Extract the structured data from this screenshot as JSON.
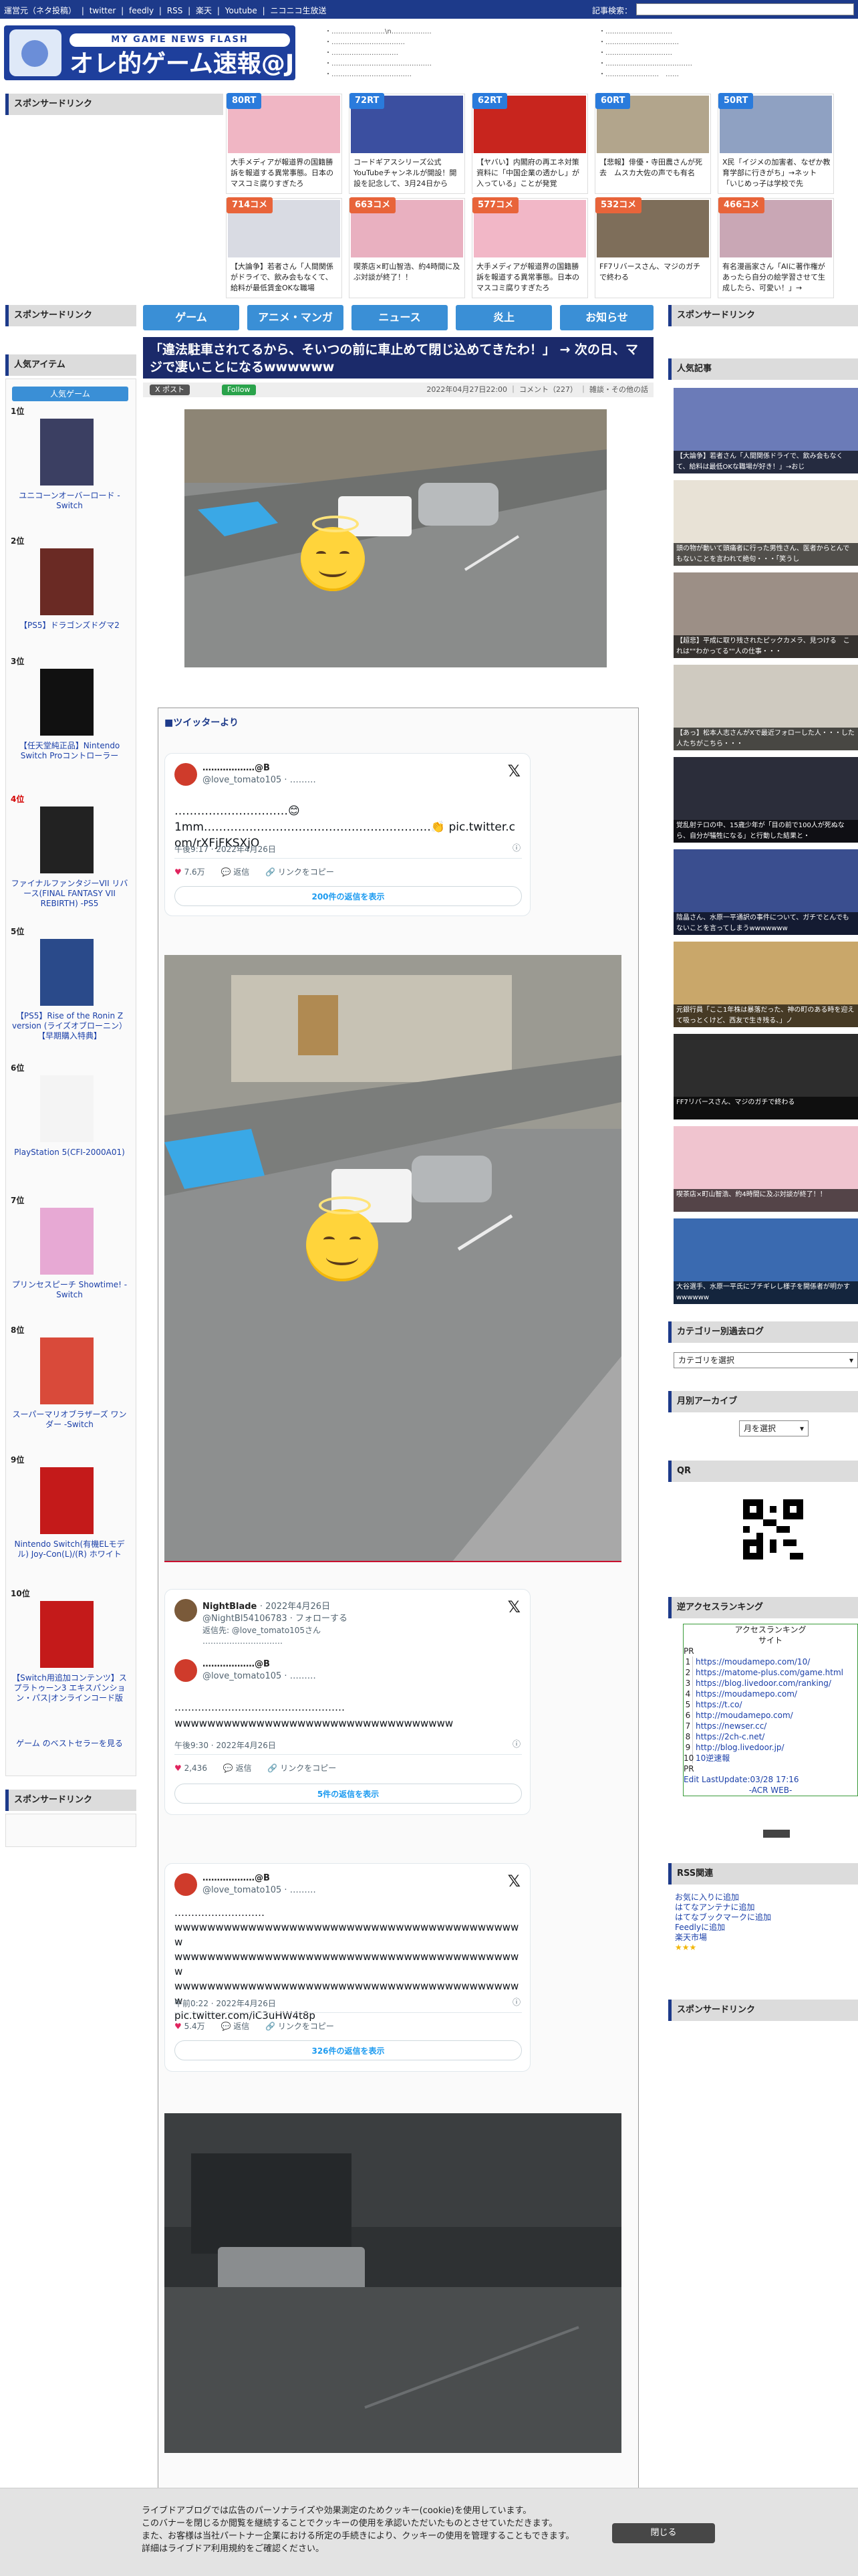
{
  "topbar": {
    "links": [
      "運営元（ネタ投稿）",
      "|",
      "twitter",
      "|",
      "feedly",
      "|",
      "RSS",
      "|",
      "楽天",
      "|",
      "Youtube",
      "|",
      "ニコニコ生放送"
    ],
    "search_label": "記事検索："
  },
  "logo": {
    "sub": "MY GAME NEWS FLASH",
    "main": "オレ的ゲーム速報@JIN"
  },
  "header_links": {
    "col1": [
      "……………………\\n………………",
      "……………………………",
      "…………………………",
      "………………………………………",
      "………………………………"
    ],
    "col2": [
      "…………………………",
      "……………………………",
      "…………………………",
      "…………………………………",
      "……………………　……"
    ]
  },
  "ads": [
    {
      "badge": "80RT",
      "kind": "rt",
      "caption": "大手メディアが報道界の国籍勝訴を報道する異常事態。日本のマスコミ腐りすぎたろ"
    },
    {
      "badge": "72RT",
      "kind": "rt",
      "caption": "コードギアスシリーズ公式YouTubeチャンネルが開設！開設を記念して、3月24日から"
    },
    {
      "badge": "62RT",
      "kind": "rt",
      "caption": "【ヤバい】内閣府の再エネ対策資料に「中国企業の透かし」が入っている」ことが発覚"
    },
    {
      "badge": "60RT",
      "kind": "rt",
      "caption": "【悲報】俳優・寺田農さんが死去　ムスカ大佐の声でも有名"
    },
    {
      "badge": "50RT",
      "kind": "rt",
      "caption": "X民「イジメの加害者、なぜか教育学部に行きがち」→ネット「いじめっ子は学校で先"
    },
    {
      "badge": "714コメ",
      "kind": "cm",
      "caption": "【大論争】若者さん「人間関係がドライで、飲み会もなくて、給料が最低賃金OKな職場"
    },
    {
      "badge": "663コメ",
      "kind": "cm",
      "caption": "喫茶店×町山智浩、約4時間に及ぶ対談が終了！！"
    },
    {
      "badge": "577コメ",
      "kind": "cm",
      "caption": "大手メディアが報道界の国籍勝訴を報道する異常事態。日本のマスコミ腐りすぎたろ"
    },
    {
      "badge": "532コメ",
      "kind": "cm",
      "caption": "FF7リバースさん、マジのガチで終わる"
    },
    {
      "badge": "466コメ",
      "kind": "cm",
      "caption": "有名漫画家さん「AIに著作権があったら自分の絵学習させて生成したら、可愛い！」→"
    }
  ],
  "side": {
    "sponsored": "スポンサードリンク",
    "popular_items": "人気アイテム",
    "popular_tab": "人気ゲーム",
    "popular_articles": "人気記事",
    "category_label": "カテゴリー別過去ログ",
    "category_select": "カテゴリを選択",
    "monthly_label": "月別アーカイブ",
    "monthly_select": "月を選択",
    "qr_label": "QR",
    "access_label": "逆アクセスランキング",
    "rss_label": "RSS関連",
    "see_more": "ゲーム のベストセラーを見る"
  },
  "nav": [
    "ゲーム",
    "アニメ・マンガ",
    "ニュース",
    "炎上",
    "お知らせ"
  ],
  "article": {
    "title": "「違法駐車されてるから、そいつの前に車止めて閉じ込めてきたわ！」 → 次の日、マジで凄いことになるwwwwww",
    "post_label": "X ポスト",
    "follow_label": "Follow",
    "meta": "2022年04月27日22:00 ｜ コメント（227） ｜ 雑談・その他の話"
  },
  "twitter_head": "■ツイッターより",
  "tweets": [
    {
      "name": "………………@B",
      "handle": "@love_tomato105 · ………",
      "body": "…………………………😊\n1mm……………………………………………………👏 pic.twitter.com/rXFjFKSXjO",
      "time": "午後9:17 · 2022年4月26日",
      "likes": "7.6万",
      "replies": "返信",
      "copy": "リンクをコピー",
      "more": "200件の返信を表示"
    },
    {
      "reply_name": "NightBlade",
      "reply_meta": "· 2022年4月26日",
      "reply_handle": "@NightBl54106783 · フォローする",
      "reply_to": "返信先: @love_tomato105さん",
      "reply_body": "…………………………",
      "name": "………………@B",
      "handle": "@love_tomato105 · ………",
      "body": "……………………………………………\nwwwwwwwwwwwwwwwwwwwwwwwwwwwwwwwwww",
      "time": "午後9:30 · 2022年4月26日",
      "likes": "2,436",
      "replies": "返信",
      "copy": "リンクをコピー",
      "more": "5件の返信を表示"
    },
    {
      "name": "………………@B",
      "handle": "@love_tomato105 · ………",
      "body": "………………………\nwwwwwwwwwwwwwwwwwwwwwwwwwwwwwwwwwwwwwwwwwww\nwwwwwwwwwwwwwwwwwwwwwwwwwwwwwwwwwwwwwwwwwww\nwwwwwwwwwwwwwwwwwwwwwwwwwwwwwwwwwwwwwwwwwww\npic.twitter.com/iC3uHW4t8p",
      "time": "午前0:22 · 2022年4月26日",
      "likes": "5.4万",
      "replies": "返信",
      "copy": "リンクをコピー",
      "more": "326件の返信を表示"
    }
  ],
  "ranking": [
    {
      "no": "1位",
      "name": "ユニコーンオーバーロード - Switch"
    },
    {
      "no": "2位",
      "name": "【PS5】ドラゴンズドグマ2"
    },
    {
      "no": "3位",
      "name": "【任天堂純正品】Nintendo Switch Proコントローラー"
    },
    {
      "no": "4位",
      "name": "ファイナルファンタジーVII リバース(FINAL FANTASY VII REBIRTH) -PS5"
    },
    {
      "no": "5位",
      "name": "【PS5】Rise of the Ronin Z version (ライズオブローニン）【早期購入特典】"
    },
    {
      "no": "6位",
      "name": "PlayStation 5(CFI-2000A01)"
    },
    {
      "no": "7位",
      "name": "プリンセスピーチ Showtime! -Switch"
    },
    {
      "no": "8位",
      "name": "スーパーマリオブラザーズ ワンダー -Switch"
    },
    {
      "no": "9位",
      "name": "Nintendo Switch(有機ELモデル) Joy-Con(L)/(R) ホワイト"
    },
    {
      "no": "10位",
      "name": "【Switch用追加コンテンツ】スプラトゥーン3 エキスパンション・パス|オンラインコード版"
    }
  ],
  "popular_articles": [
    "【大論争】若者さん「人間関係ドライで、飲み会もなくて、給料は最低OKな職場が好き！」→おじ",
    "頭の物が動いて頭痛者に行った男性さん、医者からとんでもないことを言われて絶句・・・「笑うし",
    "【超悲】平成に取り残されたピックカメラ、見つける　これは\"\"わかってる\"\"人の仕事・・・",
    "【あっ】松本人志さんがXで最近フォローした人・・・した人たちがこちら・・・",
    "覚乱射テロの中、15歳少年が「目の前で100人が死ぬなら、自分が犠牲になる」と行動した結果と・",
    "陰晶さん、水原一平通訳の事件について、ガチでとんでもないことを言ってしまうwwwwwww",
    "元銀行員「ここ1年株は暴落だった、神の町のある時を迎えて吸っとくけど、西友で生き残る、」ノ",
    "FF7リバースさん、マジのガチで終わる",
    "喫茶店×町山智浩、約4時間に及ぶ対談が終了！！",
    "大谷選手、水原一平氏にブチギレし様子を開係者が明かすwwwwww"
  ],
  "access_ranking": {
    "header1": "アクセスランキング",
    "header2": "サイト",
    "pr1": "PR",
    "sites": [
      "https://moudamepo.com/10/",
      "https://matome-plus.com/game.html",
      "https://blog.livedoor.com/ranking/",
      "https://moudamepo.com/",
      "https://t.co/",
      "http://moudamepo.com/",
      "https://newser.cc/",
      "https://2ch-c.net/",
      "http://blog.livedoor.jp/",
      "10逆速報"
    ],
    "pr2": "PR",
    "update": "Edit LastUpdate:03/28 17:16",
    "footer": "-ACR WEB-"
  },
  "rss_links": [
    "お気に入りに追加",
    "はてなアンテナに追加",
    "はてなブックマークに追加",
    "Feedlyに追加",
    "楽天市場"
  ],
  "cookie": {
    "lines": [
      "ライブドアブログでは広告のパーソナライズや効果測定のためクッキー(cookie)を使用しています。",
      "このバナーを閉じるか閲覧を継続することでクッキーの使用を承認いただいたものとさせていただきます。",
      "また、お客様は当社パートナー企業における所定の手続きにより、クッキーの使用を管理することもできます。",
      "詳細はライブドア利用規約をご確認ください。"
    ],
    "close": "閉じる"
  },
  "colors": {
    "accent": "#1d3a8a",
    "nav": "#3a8fd6",
    "title_bg": "#1b2a6a",
    "rt": "#2a7bdc",
    "comment": "#e8643a"
  }
}
